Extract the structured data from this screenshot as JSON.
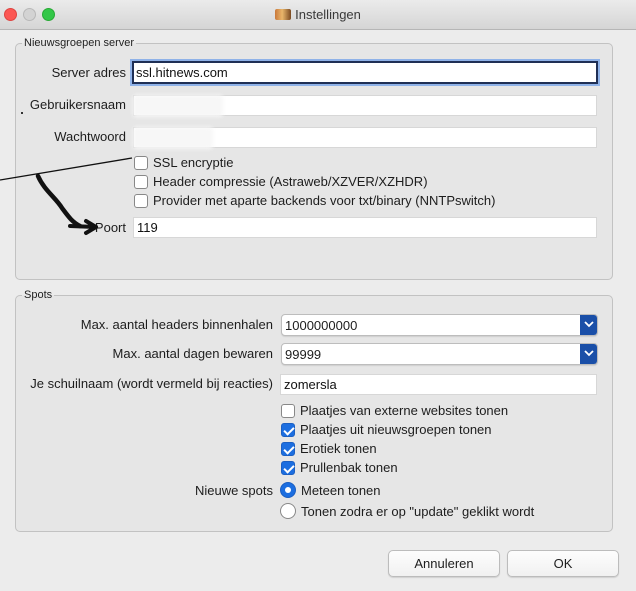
{
  "window": {
    "title": "Instellingen",
    "icon": "app-icon"
  },
  "server_group": {
    "legend": "Nieuwsgroepen server",
    "server_label": "Server adres",
    "server_value": "ssl.hitnews.com",
    "user_label": "Gebruikersnaam",
    "password_label": "Wachtwoord",
    "ssl_label": "SSL encryptie",
    "ssl_checked": false,
    "header_compression_label": "Header compressie (Astraweb/XZVER/XZHDR)",
    "header_compression_checked": false,
    "provider_label": "Provider met  aparte backends voor txt/binary (NNTPswitch)",
    "provider_checked": false,
    "port_label": "Poort",
    "port_value": "119"
  },
  "spots_group": {
    "legend": "Spots",
    "max_headers_label": "Max. aantal headers binnenhalen",
    "max_headers_value": "1000000000",
    "max_days_label": "Max. aantal dagen bewaren",
    "max_days_value": "99999",
    "nickname_label": "Je schuilnaam (wordt vermeld bij reacties)",
    "nickname_value": "zomersla",
    "checkboxes": [
      {
        "label": "Plaatjes van externe websites tonen",
        "checked": false
      },
      {
        "label": "Plaatjes uit nieuwsgroepen tonen",
        "checked": true
      },
      {
        "label": "Erotiek tonen",
        "checked": true
      },
      {
        "label": "Prullenbak tonen",
        "checked": true
      }
    ],
    "new_spots_label": "Nieuwe spots",
    "radio_options": [
      {
        "label": "Meteen tonen",
        "selected": true
      },
      {
        "label": "Tonen zodra er op \"update\" geklikt wordt",
        "selected": false
      }
    ]
  },
  "buttons": {
    "cancel": "Annuleren",
    "ok": "OK"
  },
  "colors": {
    "accent": "#1c6ee0",
    "select_arrow": "#1a4fa8"
  }
}
